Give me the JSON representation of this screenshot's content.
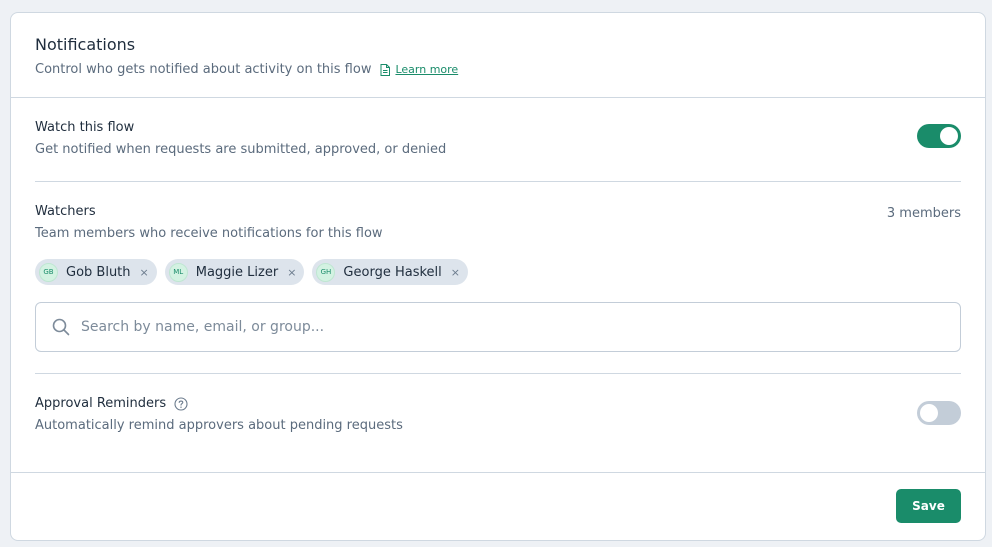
{
  "header": {
    "title": "Notifications",
    "subtitle": "Control who gets notified about activity on this flow",
    "learn_more": "Learn more",
    "learn_more_icon": "document-icon"
  },
  "watch": {
    "title": "Watch this flow",
    "description": "Get notified when requests are submitted, approved, or denied",
    "enabled": true
  },
  "watchers": {
    "title": "Watchers",
    "description": "Team members who receive notifications for this flow",
    "count_label": "3 members",
    "members": [
      {
        "initials": "GB",
        "name": "Gob Bluth"
      },
      {
        "initials": "ML",
        "name": "Maggie Lizer"
      },
      {
        "initials": "GH",
        "name": "George Haskell"
      }
    ],
    "remove_glyph": "×",
    "search": {
      "placeholder": "Search by name, email, or group...",
      "value": ""
    }
  },
  "reminders": {
    "title": "Approval Reminders",
    "description": "Automatically remind approvers about pending requests",
    "enabled": false,
    "help_icon": "question-circle-icon"
  },
  "footer": {
    "save_label": "Save"
  },
  "colors": {
    "accent": "#1a8c6a",
    "toggle_off": "#c3cdd8",
    "chip_bg": "#dde4ec",
    "avatar_bg": "#d3f2e2"
  }
}
